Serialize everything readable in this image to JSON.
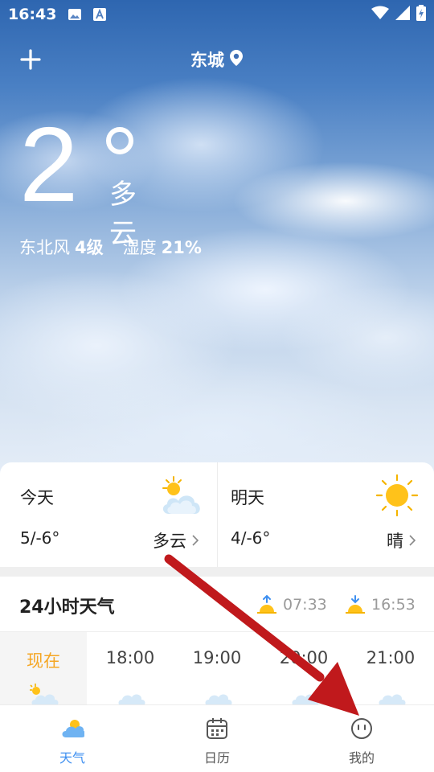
{
  "status_bar": {
    "time": "16:43",
    "icons": [
      "image-icon",
      "font-a-icon",
      "wifi-icon",
      "signal-icon",
      "battery-charging-icon"
    ]
  },
  "header": {
    "add_icon": "plus-icon",
    "city": "东城",
    "location_icon": "location-pin-icon"
  },
  "current": {
    "temperature": "2",
    "condition": "多云",
    "wind_label": "东北风",
    "wind_value": "4级",
    "humidity_label": "湿度",
    "humidity_value": "21%"
  },
  "forecast": {
    "today": {
      "label": "今天",
      "range": "5/-6°",
      "condition": "多云",
      "icon": "partly-cloudy-icon"
    },
    "tomorrow": {
      "label": "明天",
      "range": "4/-6°",
      "condition": "晴",
      "icon": "sun-icon"
    }
  },
  "hourly": {
    "title": "24小时天气",
    "sunrise": "07:33",
    "sunset": "16:53",
    "hours": [
      {
        "label": "现在",
        "active": true
      },
      {
        "label": "18:00",
        "active": false
      },
      {
        "label": "19:00",
        "active": false
      },
      {
        "label": "20:00",
        "active": false
      },
      {
        "label": "21:00",
        "active": false
      }
    ]
  },
  "tabs": [
    {
      "label": "天气",
      "icon": "weather-icon",
      "active": true
    },
    {
      "label": "日历",
      "icon": "calendar-icon",
      "active": false
    },
    {
      "label": "我的",
      "icon": "profile-face-icon",
      "active": false
    }
  ],
  "colors": {
    "accent": "#3d8ff0",
    "active_hour": "#f5a623",
    "annotation_arrow": "#c0191c"
  }
}
